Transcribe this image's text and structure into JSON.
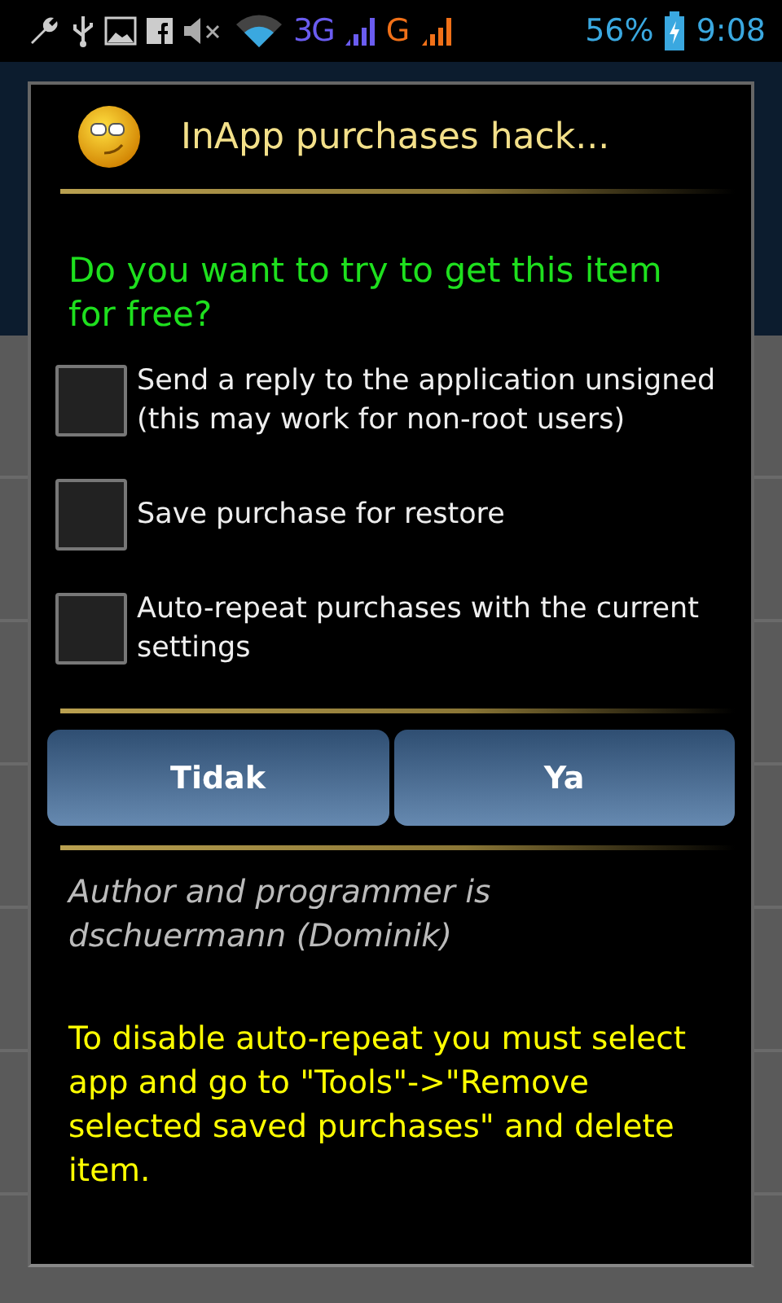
{
  "status_bar": {
    "network_1": "3G",
    "network_2": "G",
    "battery": "56%",
    "time": "9:08"
  },
  "dialog": {
    "title": "InApp purchases hack...",
    "question": "Do you want to try to get this item for free?",
    "options": [
      {
        "label": "Send a reply to the application unsigned (this may work for non-root users)",
        "checked": false
      },
      {
        "label": "Save purchase for restore",
        "checked": false
      },
      {
        "label": "Auto-repeat purchases with the current settings",
        "checked": false
      }
    ],
    "buttons": [
      "Tidak",
      "Ya"
    ],
    "author": "Author and programmer is dschuermann (Dominik)",
    "note": "To disable auto-repeat you must select app and go to \"Tools\"->\"Remove selected saved purchases\" and delete item."
  }
}
